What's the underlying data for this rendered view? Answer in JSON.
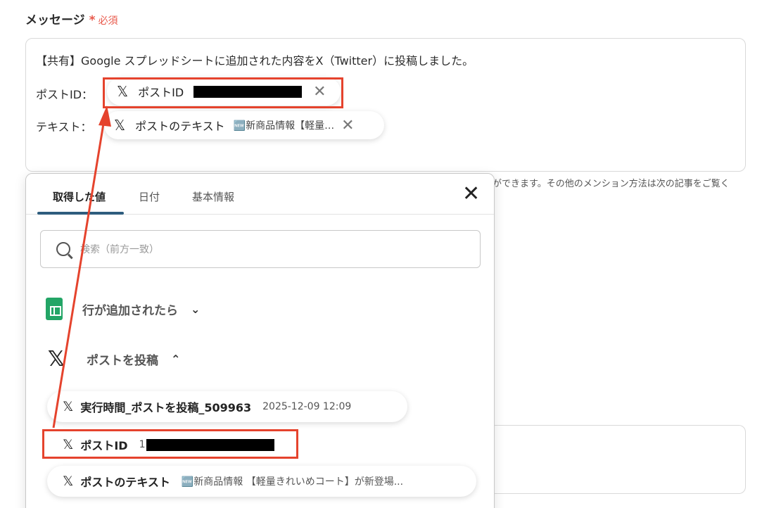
{
  "field": {
    "label": "メッセージ",
    "required_star": "*",
    "required_text": "必須"
  },
  "message": {
    "line1": "【共有】Google スプレッドシートに追加された内容をX（Twitter）に投稿しました。",
    "label_post_id": "ポストID：",
    "label_text": "テキスト：",
    "pill_post_id": {
      "icon": "x-logo-icon",
      "label": "ポストID",
      "close": "✕"
    },
    "pill_text": {
      "icon": "x-logo-icon",
      "label": "ポストのテキスト",
      "preview": "🆕新商品情報【軽量…",
      "close": "✕"
    }
  },
  "hint": "ができます。その他のメンション方法は次の記事をご覧く",
  "popup": {
    "tabs": [
      "取得した値",
      "日付",
      "基本情報"
    ],
    "active_tab": 0,
    "close": "✕",
    "search_placeholder": "検索（前方一致）",
    "groups": [
      {
        "icon": "google-sheets-icon",
        "label": "行が追加されたら",
        "chevron": "⌄"
      },
      {
        "icon": "x-logo-icon",
        "label": "ポストを投稿",
        "chevron": "⌃"
      }
    ],
    "items": [
      {
        "label": "実行時間_ポストを投稿_509963",
        "meta": "2025-12-09 12:09"
      },
      {
        "label": "ポストID",
        "meta": "1"
      },
      {
        "label": "ポストのテキスト",
        "meta": "🆕新商品情報 【軽量きれいめコート】が新登場..."
      }
    ]
  },
  "colors": {
    "highlight": "#e5432d",
    "tab_underline": "#2e5d7e",
    "required": "#e8584a",
    "sheets_green": "#23a566"
  }
}
